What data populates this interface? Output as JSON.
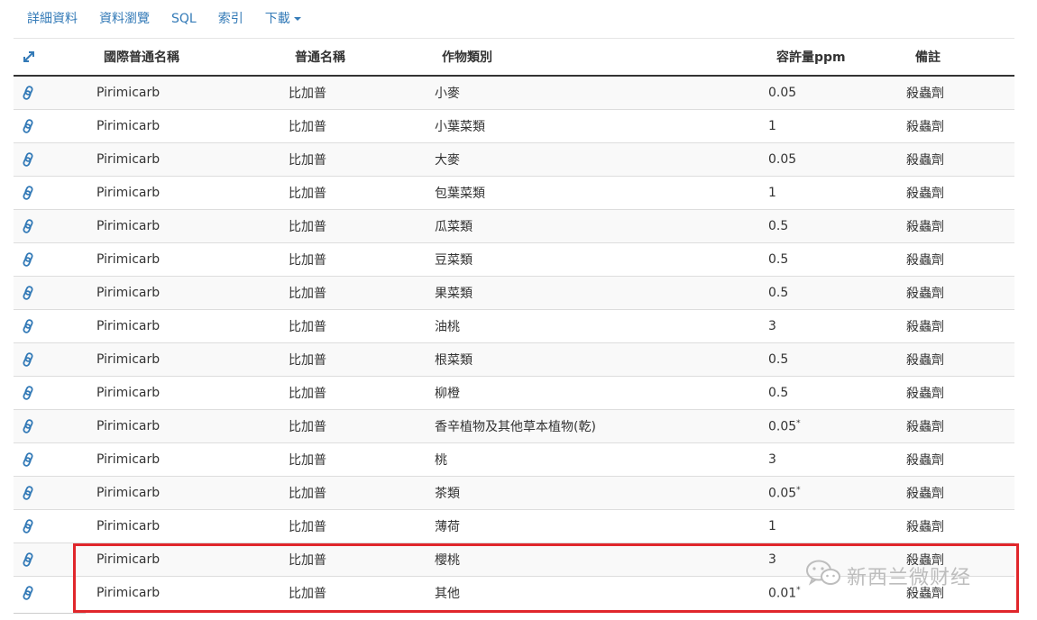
{
  "tabs": [
    {
      "label": "詳細資料"
    },
    {
      "label": "資料瀏覽"
    },
    {
      "label": "SQL"
    },
    {
      "label": "索引"
    },
    {
      "label": "下載"
    }
  ],
  "table": {
    "columns": [
      "國際普通名稱",
      "普通名稱",
      "作物類別",
      "容許量ppm",
      "備註"
    ],
    "rows": [
      {
        "intl_name": "Pirimicarb",
        "name": "比加普",
        "crop": "小麥",
        "ppm": "0.05",
        "note": "殺蟲劑"
      },
      {
        "intl_name": "Pirimicarb",
        "name": "比加普",
        "crop": "小葉菜類",
        "ppm": "1",
        "note": "殺蟲劑"
      },
      {
        "intl_name": "Pirimicarb",
        "name": "比加普",
        "crop": "大麥",
        "ppm": "0.05",
        "note": "殺蟲劑"
      },
      {
        "intl_name": "Pirimicarb",
        "name": "比加普",
        "crop": "包葉菜類",
        "ppm": "1",
        "note": "殺蟲劑"
      },
      {
        "intl_name": "Pirimicarb",
        "name": "比加普",
        "crop": "瓜菜類",
        "ppm": "0.5",
        "note": "殺蟲劑"
      },
      {
        "intl_name": "Pirimicarb",
        "name": "比加普",
        "crop": "豆菜類",
        "ppm": "0.5",
        "note": "殺蟲劑"
      },
      {
        "intl_name": "Pirimicarb",
        "name": "比加普",
        "crop": "果菜類",
        "ppm": "0.5",
        "note": "殺蟲劑"
      },
      {
        "intl_name": "Pirimicarb",
        "name": "比加普",
        "crop": "油桃",
        "ppm": "3",
        "note": "殺蟲劑"
      },
      {
        "intl_name": "Pirimicarb",
        "name": "比加普",
        "crop": "根菜類",
        "ppm": "0.5",
        "note": "殺蟲劑"
      },
      {
        "intl_name": "Pirimicarb",
        "name": "比加普",
        "crop": "柳橙",
        "ppm": "0.5",
        "note": "殺蟲劑"
      },
      {
        "intl_name": "Pirimicarb",
        "name": "比加普",
        "crop": "香辛植物及其他草本植物(乾)",
        "ppm": "0.05*",
        "note": "殺蟲劑"
      },
      {
        "intl_name": "Pirimicarb",
        "name": "比加普",
        "crop": "桃",
        "ppm": "3",
        "note": "殺蟲劑"
      },
      {
        "intl_name": "Pirimicarb",
        "name": "比加普",
        "crop": "茶類",
        "ppm": "0.05*",
        "note": "殺蟲劑"
      },
      {
        "intl_name": "Pirimicarb",
        "name": "比加普",
        "crop": "薄荷",
        "ppm": "1",
        "note": "殺蟲劑"
      },
      {
        "intl_name": "Pirimicarb",
        "name": "比加普",
        "crop": "櫻桃",
        "ppm": "3",
        "note": "殺蟲劑"
      },
      {
        "intl_name": "Pirimicarb",
        "name": "比加普",
        "crop": "其他",
        "ppm": "0.01*",
        "note": "殺蟲劑"
      }
    ]
  },
  "icons": {
    "expand": "expand-icon",
    "row_link": "link-icon",
    "watermark": "wechat-icon"
  },
  "colors": {
    "link": "#337ab7",
    "highlight": "#e0262b",
    "stripe": "#f9f9f9"
  },
  "watermark": {
    "text": "新西兰微财经"
  }
}
